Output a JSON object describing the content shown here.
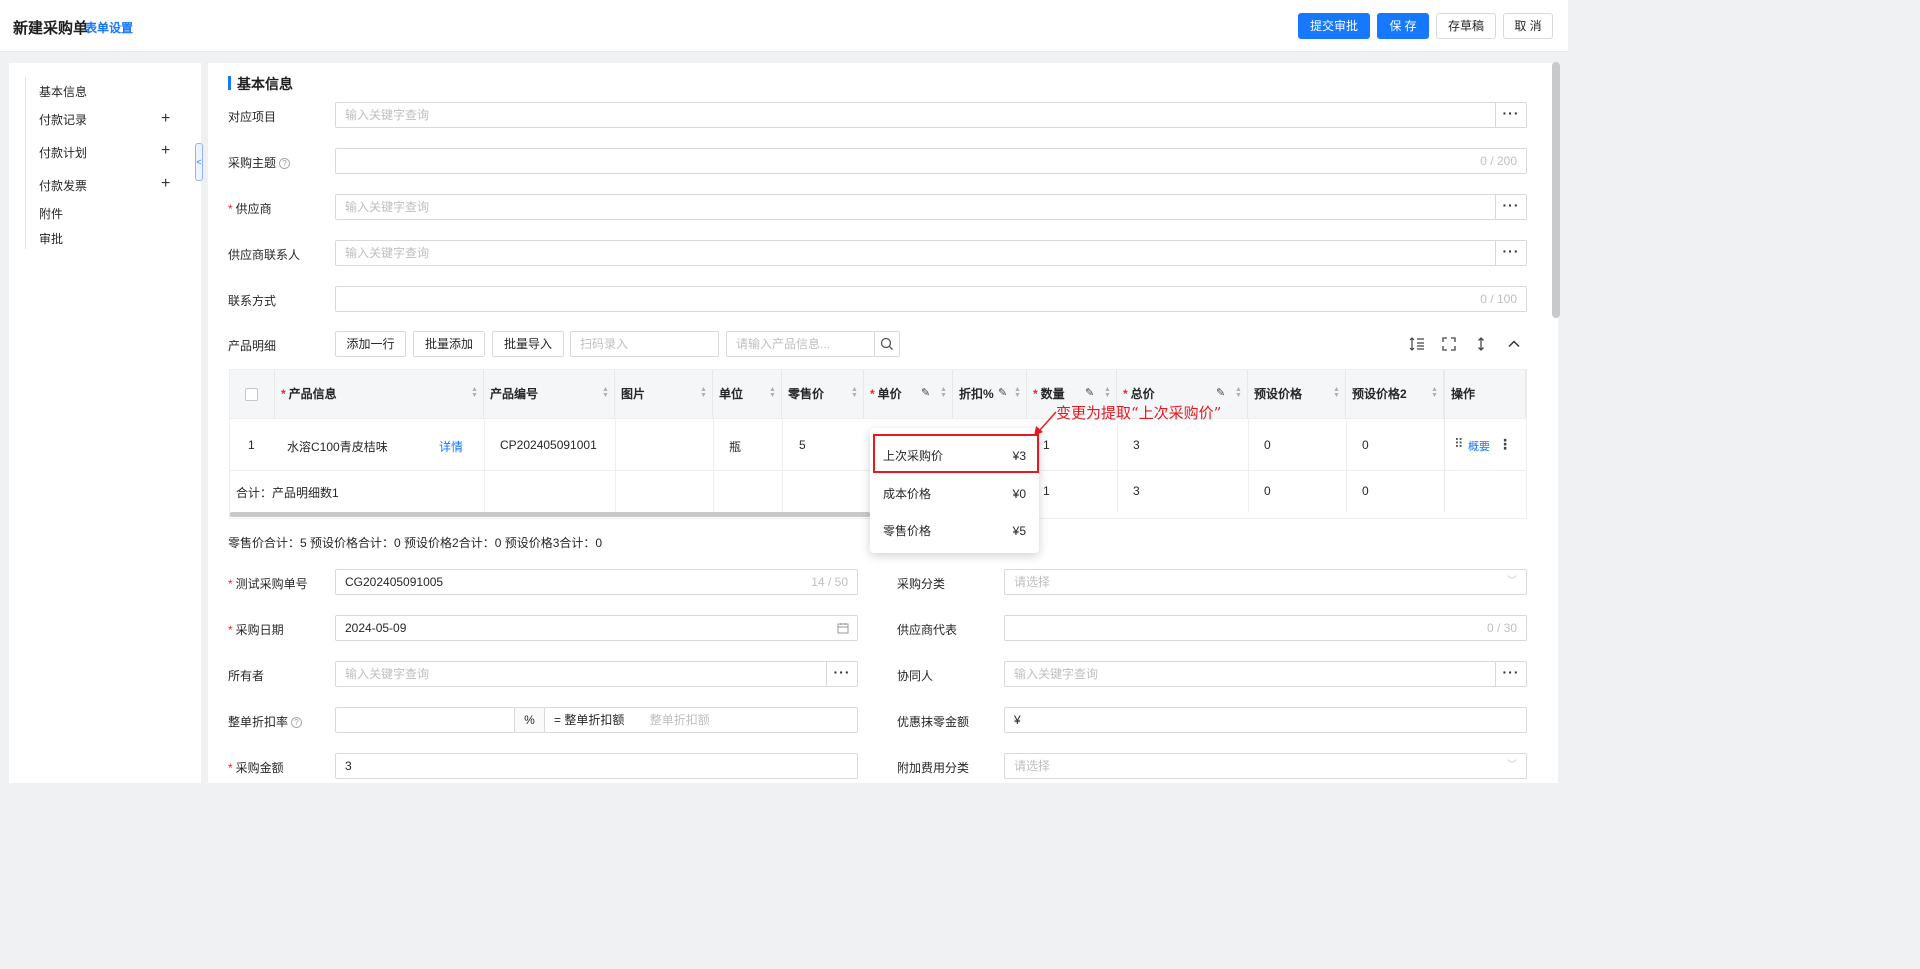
{
  "header": {
    "title": "新建采购单",
    "form_settings": "表单设置",
    "submit_label": "提交审批",
    "save_label": "保 存",
    "draft_label": "存草稿",
    "cancel_label": "取 消"
  },
  "sidebar": {
    "items": [
      {
        "label": "基本信息"
      },
      {
        "label": "付款记录",
        "has_add": true
      },
      {
        "label": "付款计划",
        "has_add": true
      },
      {
        "label": "付款发票",
        "has_add": true
      },
      {
        "label": "附件"
      },
      {
        "label": "审批"
      }
    ]
  },
  "basic": {
    "section_title": "基本信息",
    "project_label": "对应项目",
    "project_placeholder": "输入关键字查询",
    "subject_label": "采购主题",
    "subject_count": "0 / 200",
    "supplier_label": "供应商",
    "supplier_placeholder": "输入关键字查询",
    "contact_label": "供应商联系人",
    "contact_placeholder": "输入关键字查询",
    "phone_label": "联系方式",
    "phone_count": "0 / 100"
  },
  "products": {
    "label": "产品明细",
    "add_row": "添加一行",
    "batch_add": "批量添加",
    "batch_import": "批量导入",
    "scan_placeholder": "扫码录入",
    "search_placeholder": "请输入产品信息...",
    "columns": {
      "info": "产品信息",
      "code": "产品编号",
      "image": "图片",
      "unit": "单位",
      "retail": "零售价",
      "price": "单价",
      "discount": "折扣%",
      "qty": "数量",
      "total": "总价",
      "preset1": "预设价格",
      "preset2": "预设价格2",
      "action": "操作"
    },
    "row": {
      "index": "1",
      "name": "水溶C100青皮桔味",
      "detail": "详情",
      "code": "CP202405091001",
      "unit": "瓶",
      "retail": "5",
      "qty": "1",
      "total": "3",
      "preset1": "0",
      "preset2": "0",
      "summary": "概要"
    },
    "sum_row": {
      "label": "合计：产品明细数1",
      "qty": "1",
      "total": "3",
      "preset1": "0",
      "preset2": "0"
    },
    "totals_text": "零售价合计：5  预设价格合计：0  预设价格2合计：0  预设价格3合计：0"
  },
  "price_dropdown": {
    "items": [
      {
        "label": "上次采购价",
        "value": "¥3"
      },
      {
        "label": "成本价格",
        "value": "¥0"
      },
      {
        "label": "零售价格",
        "value": "¥5"
      }
    ],
    "annotation": "变更为提取“上次采购价”"
  },
  "lower": {
    "order_no_label": "测试采购单号",
    "order_no_value": "CG202405091005",
    "order_no_count": "14 / 50",
    "category_label": "采购分类",
    "category_placeholder": "请选择",
    "date_label": "采购日期",
    "date_value": "2024-05-09",
    "rep_label": "供应商代表",
    "rep_count": "0 / 30",
    "owner_label": "所有者",
    "owner_placeholder": "输入关键字查询",
    "collab_label": "协同人",
    "collab_placeholder": "输入关键字查询",
    "discount_label": "整单折扣率",
    "discount_unit": "%",
    "discount_amt_label": "= 整单折扣额",
    "discount_amt_placeholder": "整单折扣额",
    "wipe_label": "优惠抹零金额",
    "wipe_currency": "¥",
    "amount_label": "采购金额",
    "amount_value": "3",
    "extra_label": "附加费用分类",
    "extra_placeholder": "请选择"
  }
}
